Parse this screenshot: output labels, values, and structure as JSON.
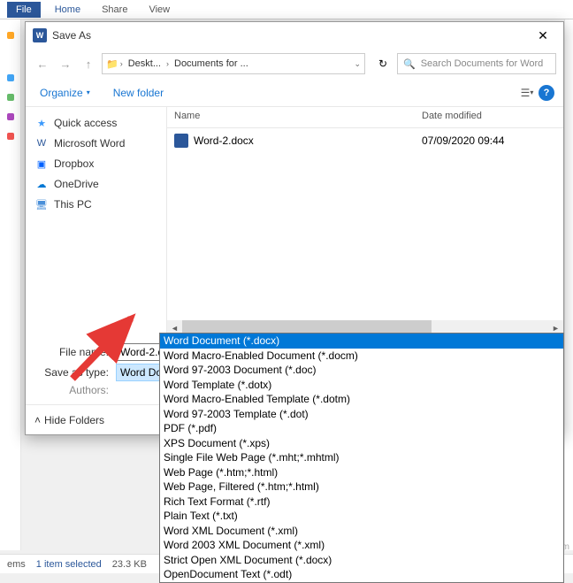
{
  "ribbon": {
    "file": "File",
    "home": "Home",
    "share": "Share",
    "view": "View"
  },
  "dialog": {
    "title": "Save As",
    "breadcrumb": {
      "seg1": "Deskt...",
      "seg2": "Documents for ..."
    },
    "search_placeholder": "Search Documents for Word",
    "organize": "Organize",
    "new_folder": "New folder",
    "columns": {
      "name": "Name",
      "date": "Date modified"
    },
    "file": {
      "name": "Word-2.docx",
      "date": "07/09/2020 09:44"
    },
    "labels": {
      "filename": "File name:",
      "savetype": "Save as type:",
      "authors": "Authors:"
    },
    "filename_value": "Word-2.docx",
    "savetype_value": "Word Document (*.docx)",
    "hide_folders": "Hide Folders"
  },
  "tree": [
    {
      "label": "Quick access",
      "color": "#3b99fc",
      "glyph": "★"
    },
    {
      "label": "Microsoft Word",
      "color": "#2b579a",
      "glyph": "W"
    },
    {
      "label": "Dropbox",
      "color": "#0061ff",
      "glyph": "▣"
    },
    {
      "label": "OneDrive",
      "color": "#0078d4",
      "glyph": "☁"
    },
    {
      "label": "This PC",
      "color": "#4a90d9",
      "glyph": "🖥"
    }
  ],
  "dropdown": {
    "selected_index": 0,
    "options": [
      "Word Document (*.docx)",
      "Word Macro-Enabled Document (*.docm)",
      "Word 97-2003 Document (*.doc)",
      "Word Template (*.dotx)",
      "Word Macro-Enabled Template (*.dotm)",
      "Word 97-2003 Template (*.dot)",
      "PDF (*.pdf)",
      "XPS Document (*.xps)",
      "Single File Web Page (*.mht;*.mhtml)",
      "Web Page (*.htm;*.html)",
      "Web Page, Filtered (*.htm;*.html)",
      "Rich Text Format (*.rtf)",
      "Plain Text (*.txt)",
      "Word XML Document (*.xml)",
      "Word 2003 XML Document (*.xml)",
      "Strict Open XML Document (*.docx)",
      "OpenDocument Text (*.odt)"
    ]
  },
  "status": {
    "items": "ems",
    "selected": "1 item selected",
    "size": "23.3 KB"
  },
  "watermark": "wsxdn.com"
}
